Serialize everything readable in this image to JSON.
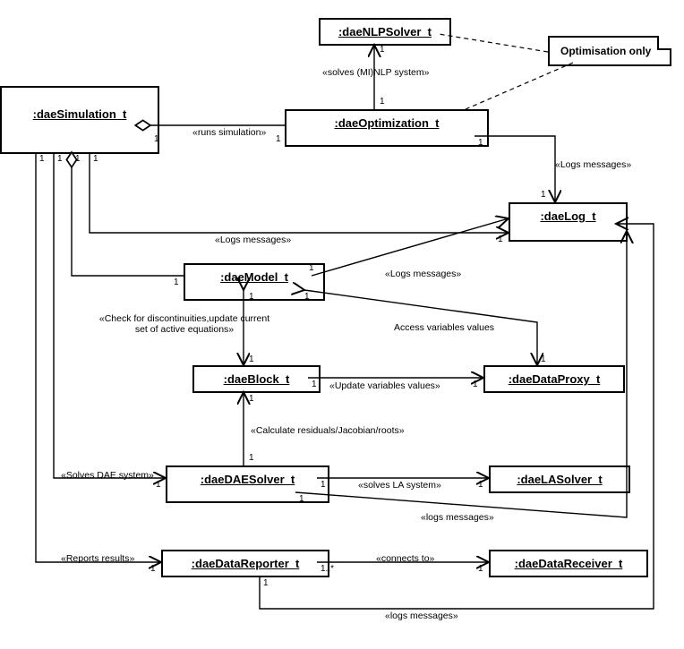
{
  "diagram": {
    "type": "UML object/collaboration diagram",
    "nodes": {
      "simulation": {
        "name": ":daeSimulation_t"
      },
      "nlpsolver": {
        "name": ":daeNLPSolver_t"
      },
      "optimization": {
        "name": ":daeOptimization_t"
      },
      "log": {
        "name": ":daeLog_t"
      },
      "model": {
        "name": ":daeModel_t"
      },
      "block": {
        "name": ":daeBlock_t"
      },
      "dataproxy": {
        "name": ":daeDataProxy_t"
      },
      "daesolver": {
        "name": ":daeDAESolver_t"
      },
      "lasolver": {
        "name": ":daeLASolver_t"
      },
      "datareporter": {
        "name": ":daeDataReporter_t"
      },
      "datareceiver": {
        "name": ":daeDataReceiver_t"
      }
    },
    "note": {
      "text": "Optimisation only"
    },
    "edges": [
      {
        "id": "opt_sim",
        "label": "«runs simulation»",
        "from": "optimization",
        "to": "simulation",
        "m_from": "1",
        "m_to": "1",
        "style": "aggregation"
      },
      {
        "id": "opt_nlp",
        "label": "«solves (MI)NLP system»",
        "from": "optimization",
        "to": "nlpsolver",
        "m_from": "1",
        "m_to": "1",
        "style": "assoc_open"
      },
      {
        "id": "opt_log",
        "label": "«Logs messages»",
        "from": "optimization",
        "to": "log",
        "m_from": "1",
        "m_to": "1",
        "style": "assoc_open"
      },
      {
        "id": "sim_log",
        "label": "«Logs messages»",
        "from": "simulation",
        "to": "log",
        "m_from": "1",
        "m_to": "1",
        "style": "assoc_open"
      },
      {
        "id": "sim_model",
        "label": "",
        "from": "simulation",
        "to": "model",
        "m_from": "1",
        "m_to": "1",
        "style": "aggregation"
      },
      {
        "id": "model_log",
        "label": "«Logs messages»",
        "from": "model",
        "to": "log",
        "m_from": "1",
        "m_to": "1",
        "style": "assoc_open"
      },
      {
        "id": "model_block",
        "label": "«Check for discontinuities,update current\nset of active equations»",
        "from": "model",
        "to": "block",
        "m_from": "1",
        "m_to": "1",
        "style": "assoc_open"
      },
      {
        "id": "model_proxy",
        "label": "Access variables values",
        "from": "model",
        "to": "dataproxy",
        "m_from": "1",
        "m_to": "1",
        "style": "assoc_open"
      },
      {
        "id": "block_proxy",
        "label": "«Update variables values»",
        "from": "block",
        "to": "dataproxy",
        "m_from": "1",
        "m_to": "1",
        "style": "assoc_open"
      },
      {
        "id": "dae_block",
        "label": "«Calculate residuals/Jacobian/roots»",
        "from": "daesolver",
        "to": "block",
        "m_from": "1",
        "m_to": "1",
        "style": "assoc_open"
      },
      {
        "id": "sim_dae",
        "label": "«Solves DAE system»",
        "from": "simulation",
        "to": "daesolver",
        "m_from": "1",
        "m_to": "1",
        "style": "assoc_open"
      },
      {
        "id": "dae_la",
        "label": "«solves LA system»",
        "from": "daesolver",
        "to": "lasolver",
        "m_from": "1",
        "m_to": "1",
        "style": "assoc_open"
      },
      {
        "id": "dae_log",
        "label": "«logs messages»",
        "from": "daesolver",
        "to": "log",
        "m_from": "1",
        "m_to": "1",
        "style": "assoc_open"
      },
      {
        "id": "sim_rep",
        "label": "«Reports results»",
        "from": "simulation",
        "to": "datareporter",
        "m_from": "1",
        "m_to": "1",
        "style": "assoc_open"
      },
      {
        "id": "rep_recv",
        "label": "«connects to»",
        "from": "datareporter",
        "to": "datareceiver",
        "m_from": "1..*",
        "m_to": "1",
        "style": "assoc_open"
      },
      {
        "id": "rep_log",
        "label": "«logs messages»",
        "from": "datareporter",
        "to": "log",
        "m_from": "1",
        "m_to": "1",
        "style": "assoc_open"
      },
      {
        "id": "note_opt",
        "label": "",
        "from": "note",
        "to": "optimization",
        "style": "dashed"
      },
      {
        "id": "note_nlp",
        "label": "",
        "from": "note",
        "to": "nlpsolver",
        "style": "dashed"
      }
    ]
  }
}
